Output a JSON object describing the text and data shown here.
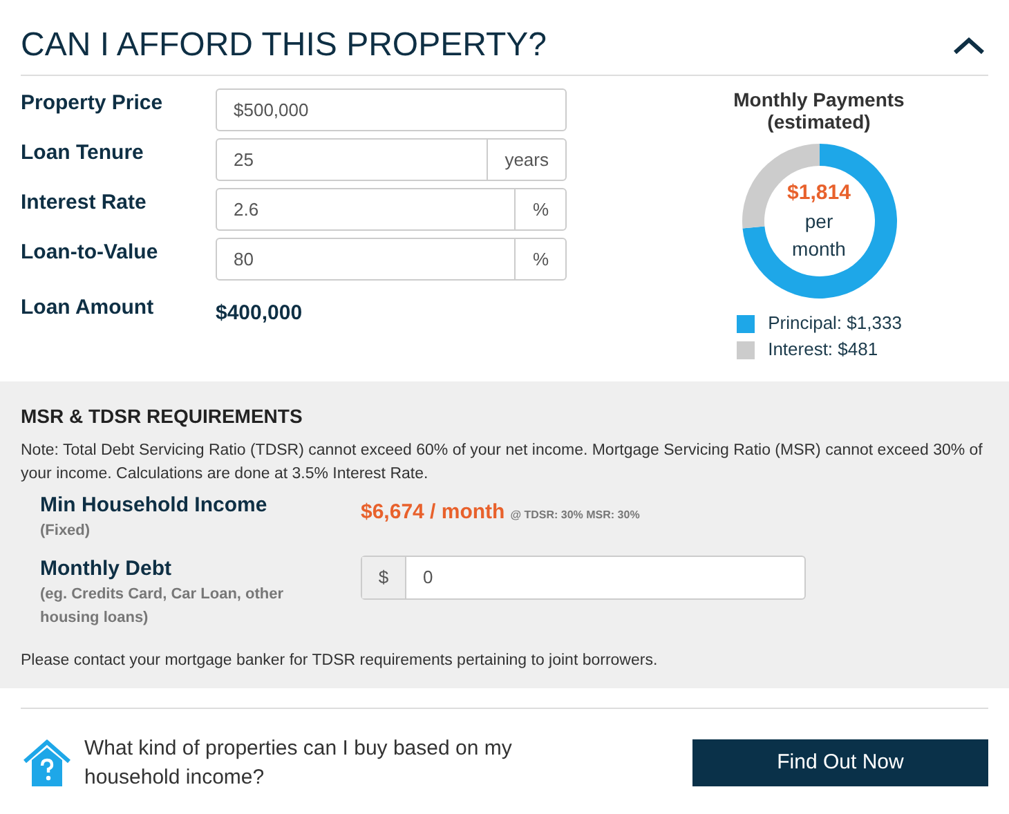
{
  "header": {
    "title": "CAN I AFFORD THIS PROPERTY?",
    "expanded": true
  },
  "fields": [
    {
      "label": "Property Price",
      "value": "$500,000"
    },
    {
      "label": "Loan Tenure",
      "value": "25",
      "suffix": "years"
    },
    {
      "label": "Interest Rate",
      "value": "2.6",
      "suffix": "%"
    },
    {
      "label": "Loan-to-Value",
      "value": "80",
      "suffix": "%"
    }
  ],
  "loan_amount": {
    "label": "Loan Amount",
    "value": "$400,000"
  },
  "payments": {
    "subtitle": "(estimated)",
    "amount": "$1,814",
    "unit_line1": "per",
    "unit_line2": "month",
    "chart_data": {
      "type": "donut",
      "series": [
        {
          "name": "Monthly Payments",
          "values": [
            73.5,
            26.5
          ]
        }
      ]
    },
    "legend": [
      {
        "label": "Principal: $1,333",
        "color": "#1ea7e8"
      },
      {
        "label": "Interest: $481",
        "color": "#cccccc"
      }
    ]
  },
  "requirements": {
    "title": "MSR & TDSR REQUIREMENTS",
    "note": "Note: Total Debt Servicing Ratio (TDSR) cannot exceed 60% of your net income. Mortgage Servicing Ratio (MSR) cannot exceed 30% of your income. Calculations are done at 3.5% Interest Rate.",
    "income_label": "Min Household Income",
    "income_sub": "(Fixed)",
    "income_value": "$6,674 / month",
    "income_ratio": "@ TDSR: 30% MSR: 30%",
    "debt_label": "Monthly Debt",
    "debt_sub": "(eg. Credits Card, Car Loan, other housing loans)",
    "debt_prefix": "$",
    "debt_value": "0",
    "footnote": "Please contact your mortgage banker for TDSR requirements pertaining to joint borrowers."
  },
  "footer": {
    "question": "What kind of properties can I buy based on my household income?",
    "button": "Find Out Now"
  }
}
